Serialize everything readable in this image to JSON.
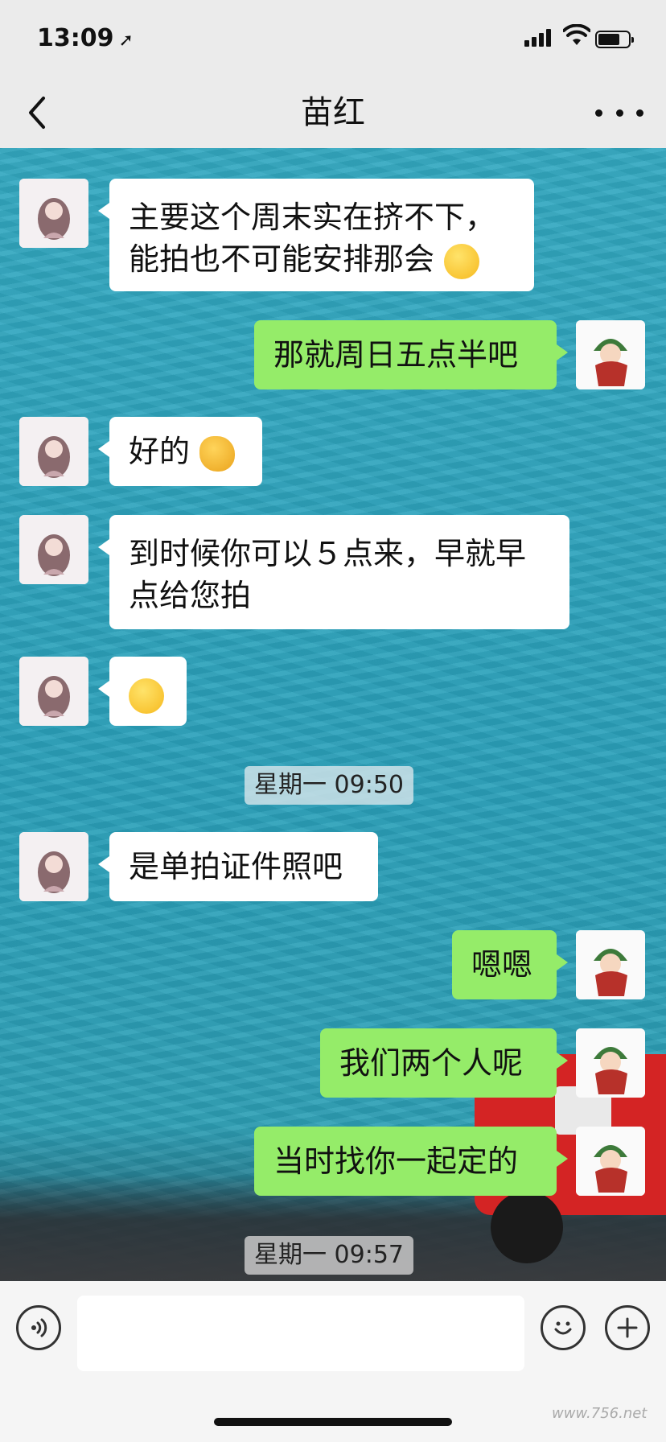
{
  "status": {
    "time": "13:09",
    "location_icon": "location-arrow-icon"
  },
  "nav": {
    "title": "苗红",
    "back_icon": "chevron-left-icon",
    "more_icon": "more-dots-icon"
  },
  "messages": [
    {
      "dir": "in",
      "text": "主要这个周末实在挤不下，",
      "text2": "能拍也不可能安排那会",
      "emoji": "loudly-crying-face"
    },
    {
      "dir": "out",
      "text": "那就周日五点半吧"
    },
    {
      "dir": "in",
      "text": "好的",
      "emoji": "ok-hand"
    },
    {
      "dir": "in",
      "text": "到时候你可以５点来，早就早",
      "text2": "点给您拍"
    },
    {
      "dir": "in",
      "emoji": "facepalm-face"
    },
    {
      "dir": "in",
      "text": "是单拍证件照吧"
    },
    {
      "dir": "out",
      "text": "嗯嗯"
    },
    {
      "dir": "out",
      "text": "我们两个人呢"
    },
    {
      "dir": "out",
      "text": "当时找你一起定的"
    }
  ],
  "timestamps": [
    "星期一 09:50",
    "星期一 09:57"
  ],
  "input": {
    "placeholder": ""
  },
  "watermark": "www.756.net",
  "colors": {
    "outgoing_bubble": "#95ec69",
    "incoming_bubble": "#ffffff",
    "wallpaper": "#2aa3bd"
  }
}
